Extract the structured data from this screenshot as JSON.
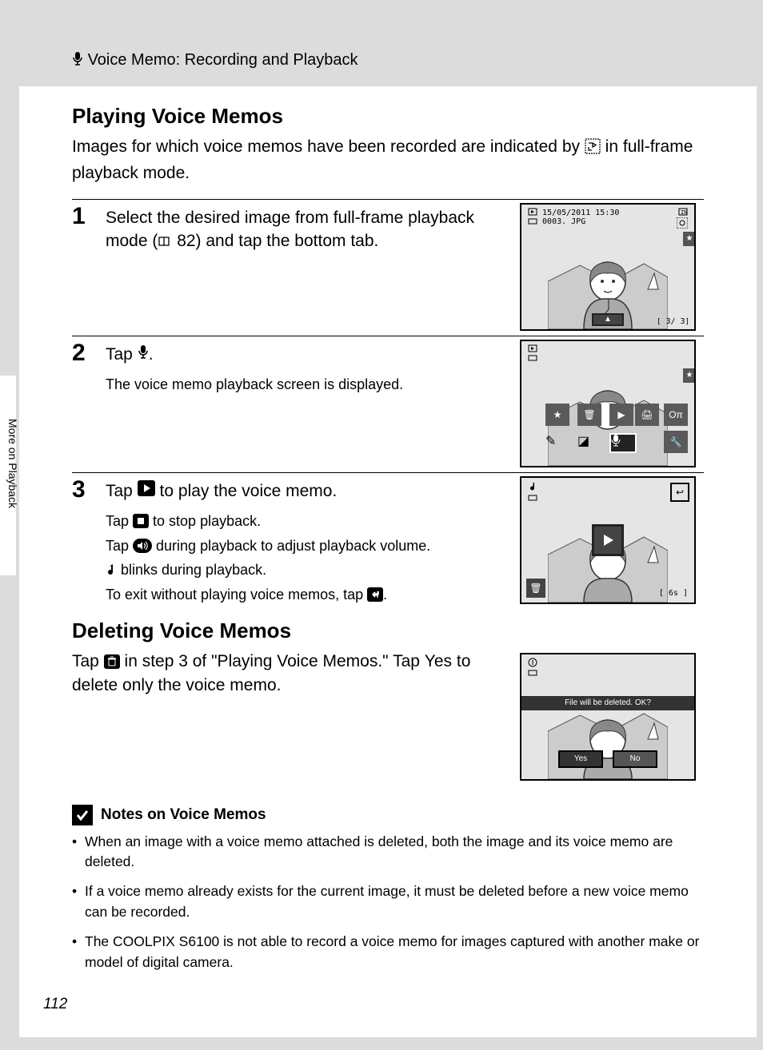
{
  "header": {
    "title": "Voice Memo: Recording and Playback"
  },
  "section1": {
    "heading": "Playing Voice Memos",
    "intro_before": "Images for which voice memos have been recorded are indicated by ",
    "intro_after": " in full-frame playback mode."
  },
  "steps": [
    {
      "num": "1",
      "title_before": "Select the desired image from full-frame playback mode (",
      "title_ref": " 82) and tap the bottom tab.",
      "sub": "",
      "screenshot": {
        "date": "15/05/2011 15:30",
        "filename": "0003. JPG",
        "counter": "3/   3",
        "has_star": true,
        "bottom_tab": true
      }
    },
    {
      "num": "2",
      "title_before": "Tap ",
      "title_after": ".",
      "sub": "The voice memo playback screen is displayed.",
      "screenshot": {
        "has_star": true,
        "grid": true
      }
    },
    {
      "num": "3",
      "title_before": "Tap ",
      "title_after": " to play the voice memo.",
      "sub_lines": [
        {
          "pre": "Tap ",
          "icon": "stop",
          "post": " to stop playback."
        },
        {
          "pre": "Tap ",
          "icon": "volume",
          "post": " during playback to adjust playback volume."
        },
        {
          "pre": "",
          "icon": "note",
          "post": " blinks during playback."
        },
        {
          "pre": "To exit without playing voice memos, tap ",
          "icon": "back",
          "post": "."
        }
      ],
      "screenshot": {
        "play": true,
        "time": "6s",
        "back": true,
        "trash": true,
        "note_icon": true
      }
    }
  ],
  "section2": {
    "heading": "Deleting Voice Memos",
    "text_before": "Tap ",
    "text_mid": " in step 3 of \"Playing Voice Memos.\" Tap ",
    "bold": "Yes",
    "text_after": " to delete only the voice memo.",
    "screenshot": {
      "msg": "File will be deleted. OK?",
      "yes": "Yes",
      "no": "No"
    }
  },
  "notes": {
    "title": "Notes on Voice Memos",
    "items": [
      "When an image with a voice memo attached is deleted, both the image and its voice memo are deleted.",
      "If a voice memo already exists for the current image, it must be deleted before a new voice memo can be recorded.",
      "The COOLPIX S6100 is not able to record a voice memo for images captured with another make or model of digital camera."
    ]
  },
  "sidebar": "More on Playback",
  "page_number": "112"
}
